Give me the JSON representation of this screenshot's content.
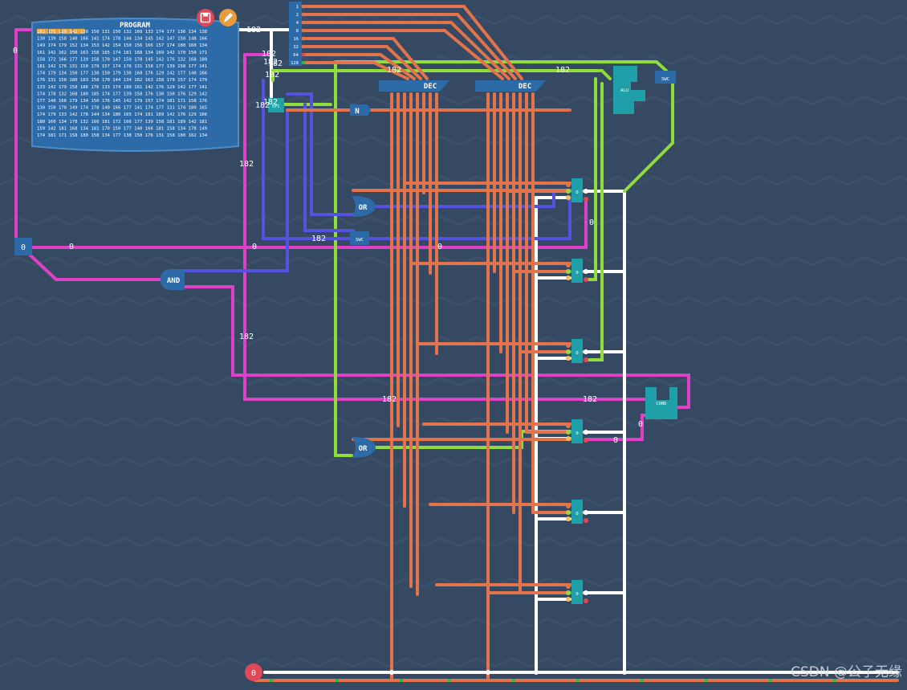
{
  "program": {
    "title": "PROGRAM",
    "rows": [
      "182 175 129 142 130 150 131 150 132 168 133 174 177 136 134 138",
      "130 139 158 140 166 141 174 178 144 134 145 142 147 150 148 166",
      "149 174 179 152 134 153 142 154 150 156 166 157 174 180 160 134",
      "161 142 162 150 163 158 165 174 181 168 134 169 142 170 150 171",
      "158 172 166 177 139 158 170 147 150 178 145 142 176 132 168 180",
      "181 142 176 131 150 179 157 174 176 131 158 177 139 158 177 141",
      "174 179 134 150 177 138 150 179 136 168 176 129 142 177 140 166",
      "176 131 158 180 183 158 170 144 134 182 163 158 179 157 174 179",
      "133 142 179 158 186 176 133 174 180 161 142 176 129 142 177 141",
      "174 178 132 168 180 185 174 177 139 158 176 130 150 176 129 142",
      "177 140 166 179 134 150 176 145 142 179 157 174 181 171 158 176",
      "130 150 178 149 174 178 140 166 177 141 174 177 131 174 180 165",
      "174 179 133 142 178 144 134 180 165 174 181 169 142 176 129 166",
      "180 160 134 178 132 166 181 172 166 177 139 158 181 189 142 181",
      "159 142 181 168 134 181 170 150 177 140 166 181 158 134 178 149",
      "174 181 171 158 180 158 134 177 138 150 176 131 158 180 162 134"
    ],
    "highlight_count": 4
  },
  "buttons": {
    "save_icon": "save-icon",
    "edit_icon": "pencil-icon"
  },
  "bit_labels": [
    "1",
    "2",
    "4",
    "8",
    "16",
    "32",
    "64",
    "128"
  ],
  "labels": {
    "prog_value": "182",
    "bus_182_a": "182",
    "bus_182_b": "182",
    "bus_182_c": "182",
    "bus_182_d": "182",
    "bus_182_e": "182",
    "bus_182_f": "182",
    "bus_182_g": "182",
    "mid_182": "182",
    "mid_182_b": "182",
    "small_182_a": "182",
    "small_182_b": "182",
    "small_182_c": "182",
    "small_182_d": "182",
    "zero_left": "0",
    "zero_a": "0",
    "zero_b": "0",
    "zero_c": "0",
    "zero_d": "0",
    "zero_e": "0",
    "zero_f": "0",
    "reg_zero": "0",
    "counter_zero": "0",
    "watermark": "CSDN @公子无缘"
  },
  "gates": {
    "dec1": "DEC",
    "dec2": "DEC",
    "alu": "ALU",
    "swc_top": "SWC",
    "swc_mid": "SWC",
    "or_top": "OR",
    "or_bottom": "OR",
    "and": "AND",
    "not": "N",
    "cond": "COND",
    "ofc": "OFC"
  },
  "registers": [
    "0",
    "0",
    "0",
    "0",
    "0",
    "0"
  ],
  "colors": {
    "background": "#354a62",
    "orange": "#e2734a",
    "pink": "#e040c8",
    "green": "#8fdc3a",
    "blue": "#5552e0",
    "white": "#ffffff",
    "teal": "#1fa0a8",
    "gate": "#2d6aa8",
    "red": "#e04858"
  }
}
